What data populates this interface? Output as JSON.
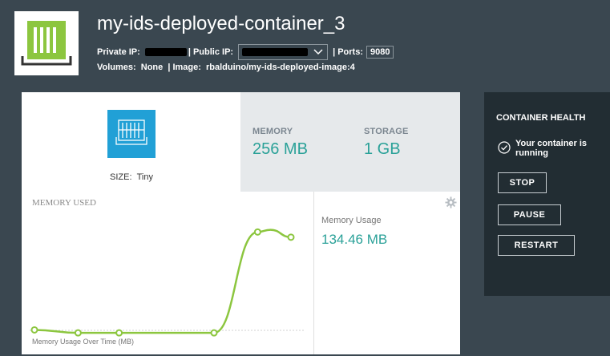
{
  "header": {
    "title": "my-ids-deployed-container_3",
    "private_ip_label": "Private IP:",
    "private_ip_value": "(redacted)",
    "public_ip_label": "| Public IP:",
    "public_ip_value": "(redacted)",
    "public_ip_dropdown_icon": "chevron-down-icon",
    "ports_label": "| Ports:",
    "ports_value": "9080",
    "volumes_label": "Volumes:",
    "volumes_value": "None",
    "image_sep": "| Image:",
    "image_value": "rbalduino/my-ids-deployed-image:4",
    "logo_icon": "container-icon"
  },
  "size": {
    "label": "SIZE:",
    "value": "Tiny",
    "icon": "container-size-icon"
  },
  "stats": {
    "memory_label": "MEMORY",
    "memory_value": "256 MB",
    "storage_label": "STORAGE",
    "storage_value": "1 GB"
  },
  "chart": {
    "title": "MEMORY USED",
    "caption": "Memory Usage Over Time (MB)",
    "settings_icon": "gear-icon"
  },
  "usage": {
    "label": "Memory Usage",
    "value": "134.46 MB"
  },
  "health": {
    "title": "CONTAINER HEALTH",
    "status_icon": "check-circle-icon",
    "status_text": "Your container is running",
    "stop_label": "STOP",
    "pause_label": "PAUSE",
    "restart_label": "RESTART"
  },
  "colors": {
    "accent_teal": "#2aa198",
    "line_green": "#8cc63f",
    "size_icon_blue": "#21a0d6",
    "logo_green": "#8cc63f",
    "page_bg": "#3a4750",
    "panel_bg": "#222d33"
  },
  "chart_data": {
    "type": "line",
    "title": "MEMORY USED",
    "xlabel": "",
    "ylabel": "",
    "caption": "Memory Usage Over Time (MB)",
    "series": [
      {
        "values": [
          6,
          2,
          2,
          2,
          2,
          138,
          141,
          131
        ]
      }
    ],
    "ylim": [
      0,
      160
    ],
    "grid": false
  }
}
